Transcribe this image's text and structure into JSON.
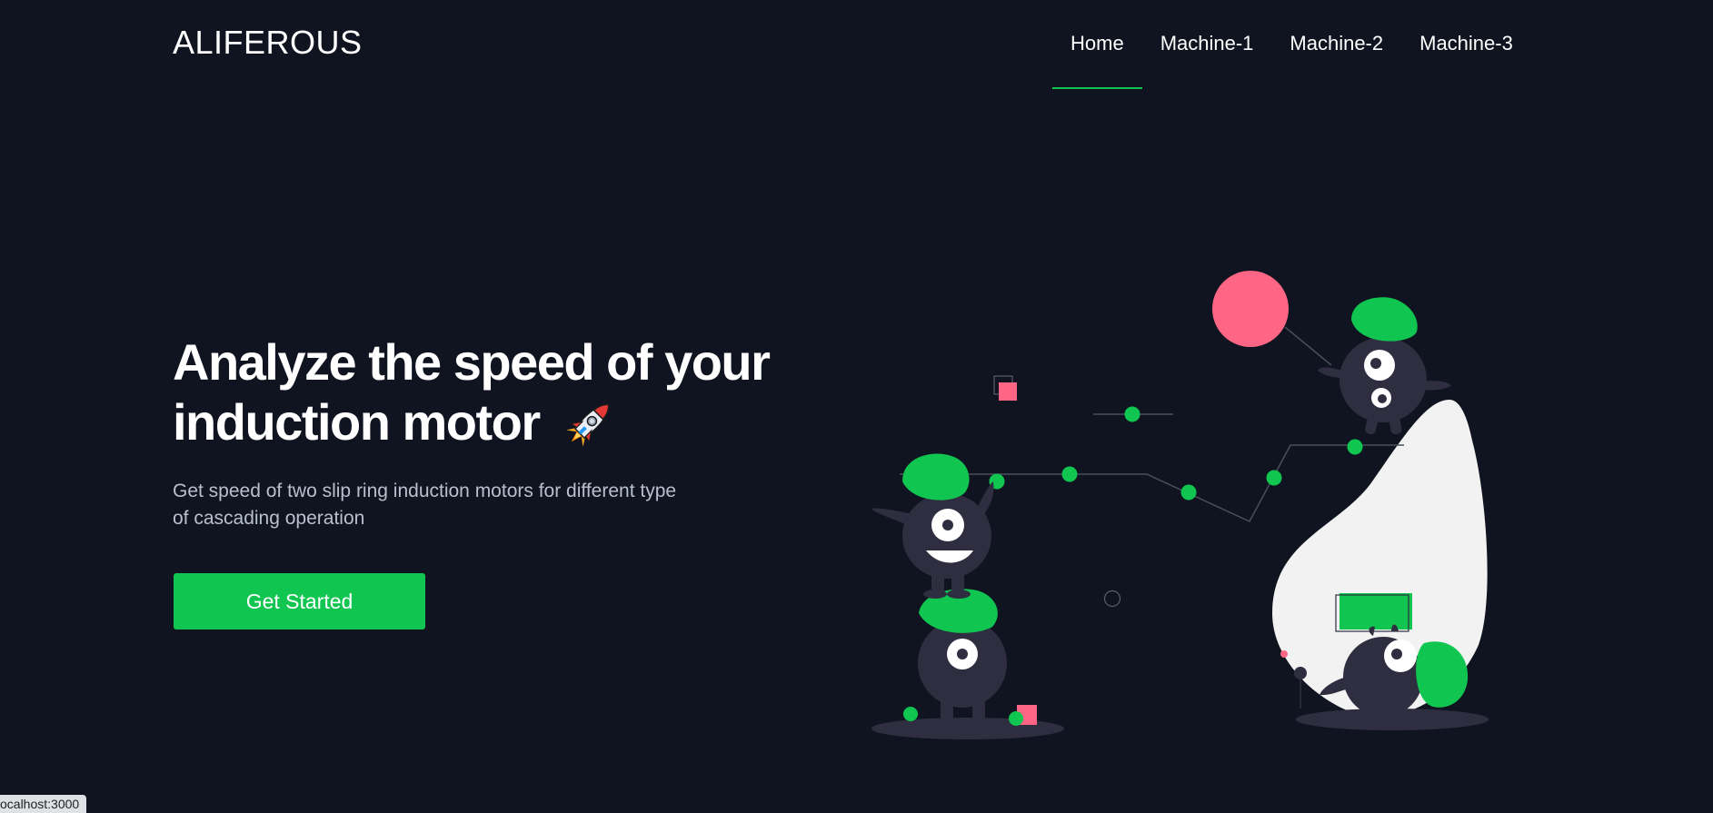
{
  "header": {
    "logo": "ALIFEROUS",
    "nav": [
      {
        "label": "Home",
        "active": true
      },
      {
        "label": "Machine-1",
        "active": false
      },
      {
        "label": "Machine-2",
        "active": false
      },
      {
        "label": "Machine-3",
        "active": false
      }
    ]
  },
  "hero": {
    "title_line1": "Analyze the speed of your",
    "title_line2": "induction motor",
    "rocket_icon": "rocket-icon",
    "subtitle": "Get speed of two slip ring induction motors for different type of cascading operation",
    "cta_label": "Get Started"
  },
  "status_bar": {
    "text": "ocalhost:3000"
  },
  "colors": {
    "background": "#0f1420",
    "accent": "#10c650",
    "pink": "#ff6584",
    "monster": "#2f2e41"
  }
}
